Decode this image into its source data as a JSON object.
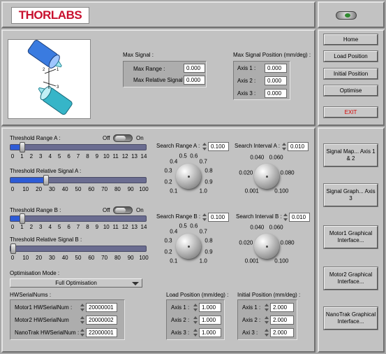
{
  "logo": "THORLABS",
  "max_signal": {
    "title": "Max Signal :",
    "range_label": "Max Range :",
    "range_value": "0.000",
    "rel_label": "Max Relative Signal :",
    "rel_value": "0.000"
  },
  "max_pos": {
    "title": "Max Signal Position (mm/deg) :",
    "axis1_label": "Axis 1 :",
    "axis1": "0.000",
    "axis2_label": "Axis 2 :",
    "axis2": "0.000",
    "axis3_label": "Axis 3 :",
    "axis3": "0.000"
  },
  "nav": {
    "home": "Home",
    "load": "Load Position",
    "initial": "Initial Position",
    "optimise": "Optimise",
    "exit": "EXIT"
  },
  "tools": {
    "signal_map": "Signal Map... Axis 1 & 2",
    "signal_graph": "Signal Graph... Axis 3",
    "motor1": "Motor1 Graphical Interface...",
    "motor2": "Motor2 Graphical Interface...",
    "nanotrak": "NanoTrak Graphical Interface..."
  },
  "threshold_a": {
    "label": "Threshold Range A :",
    "off": "Off",
    "on": "On",
    "ticks": [
      "0",
      "1",
      "2",
      "3",
      "4",
      "5",
      "6",
      "7",
      "8",
      "9",
      "10",
      "11",
      "12",
      "13",
      "14"
    ],
    "value": 1
  },
  "threshold_rel_a": {
    "label": "Threshold Relative Signal A :",
    "ticks": [
      "0",
      "10",
      "20",
      "30",
      "40",
      "50",
      "60",
      "70",
      "80",
      "90",
      "100"
    ],
    "value": 25
  },
  "threshold_b": {
    "label": "Threshold Range B :",
    "off": "Off",
    "on": "On",
    "ticks": [
      "0",
      "1",
      "2",
      "3",
      "4",
      "5",
      "6",
      "7",
      "8",
      "9",
      "10",
      "11",
      "12",
      "13",
      "14"
    ],
    "value": 1
  },
  "threshold_rel_b": {
    "label": "Threshold Relative Signal B :",
    "ticks": [
      "0",
      "10",
      "20",
      "30",
      "40",
      "50",
      "60",
      "70",
      "80",
      "90",
      "100"
    ],
    "value": 0
  },
  "search_range_a": {
    "label": "Search Range A :",
    "value": "0.100",
    "scale": [
      "0.1",
      "0.2",
      "0.3",
      "0.4",
      "0.5",
      "0.6",
      "0.7",
      "0.8",
      "0.9",
      "1.0"
    ]
  },
  "search_interval_a": {
    "label": "Search Interval A :",
    "value": "0.010",
    "scale": [
      "0.001",
      "0.020",
      "0.040",
      "0.060",
      "0.080",
      "0.100"
    ]
  },
  "search_range_b": {
    "label": "Search Range B :",
    "value": "0.100",
    "scale": [
      "0.1",
      "0.2",
      "0.3",
      "0.4",
      "0.5",
      "0.6",
      "0.7",
      "0.8",
      "0.9",
      "1.0"
    ]
  },
  "search_interval_b": {
    "label": "Search Interval B :",
    "value": "0.010",
    "scale": [
      "0.001",
      "0.020",
      "0.040",
      "0.060",
      "0.080",
      "0.100"
    ]
  },
  "opt_mode": {
    "label": "Optimisation Mode :",
    "value": "Full Optimisation"
  },
  "serials": {
    "title": "HWSerialNums :",
    "m1_label": "Motor1 HWSerialNum :",
    "m1": "20000001",
    "m2_label": "Motor2 HWSerialNum",
    "m2": "20000002",
    "nt_label": "NanoTrak HWSerialNum :",
    "nt": "22000001"
  },
  "load_pos": {
    "title": "Load Position (mm/deg) :",
    "a1_label": "Axis 1 :",
    "a1": "1.000",
    "a2_label": "Axis 2 :",
    "a2": "1.000",
    "a3_label": "Axis 3 :",
    "a3": "1.000"
  },
  "init_pos": {
    "title": "Initial Position (mm/deg) :",
    "a1_label": "Axis 1 :",
    "a1": "2.000",
    "a2_label": "Axis 2 :",
    "a2": "2.000",
    "a3_label": "Axi 3 :",
    "a3": "2.000"
  },
  "colors": {
    "logo_red": "#c8102e",
    "slider_fill": "#2d5bd6",
    "led": "#2f8a2f",
    "exit": "#d40000"
  }
}
